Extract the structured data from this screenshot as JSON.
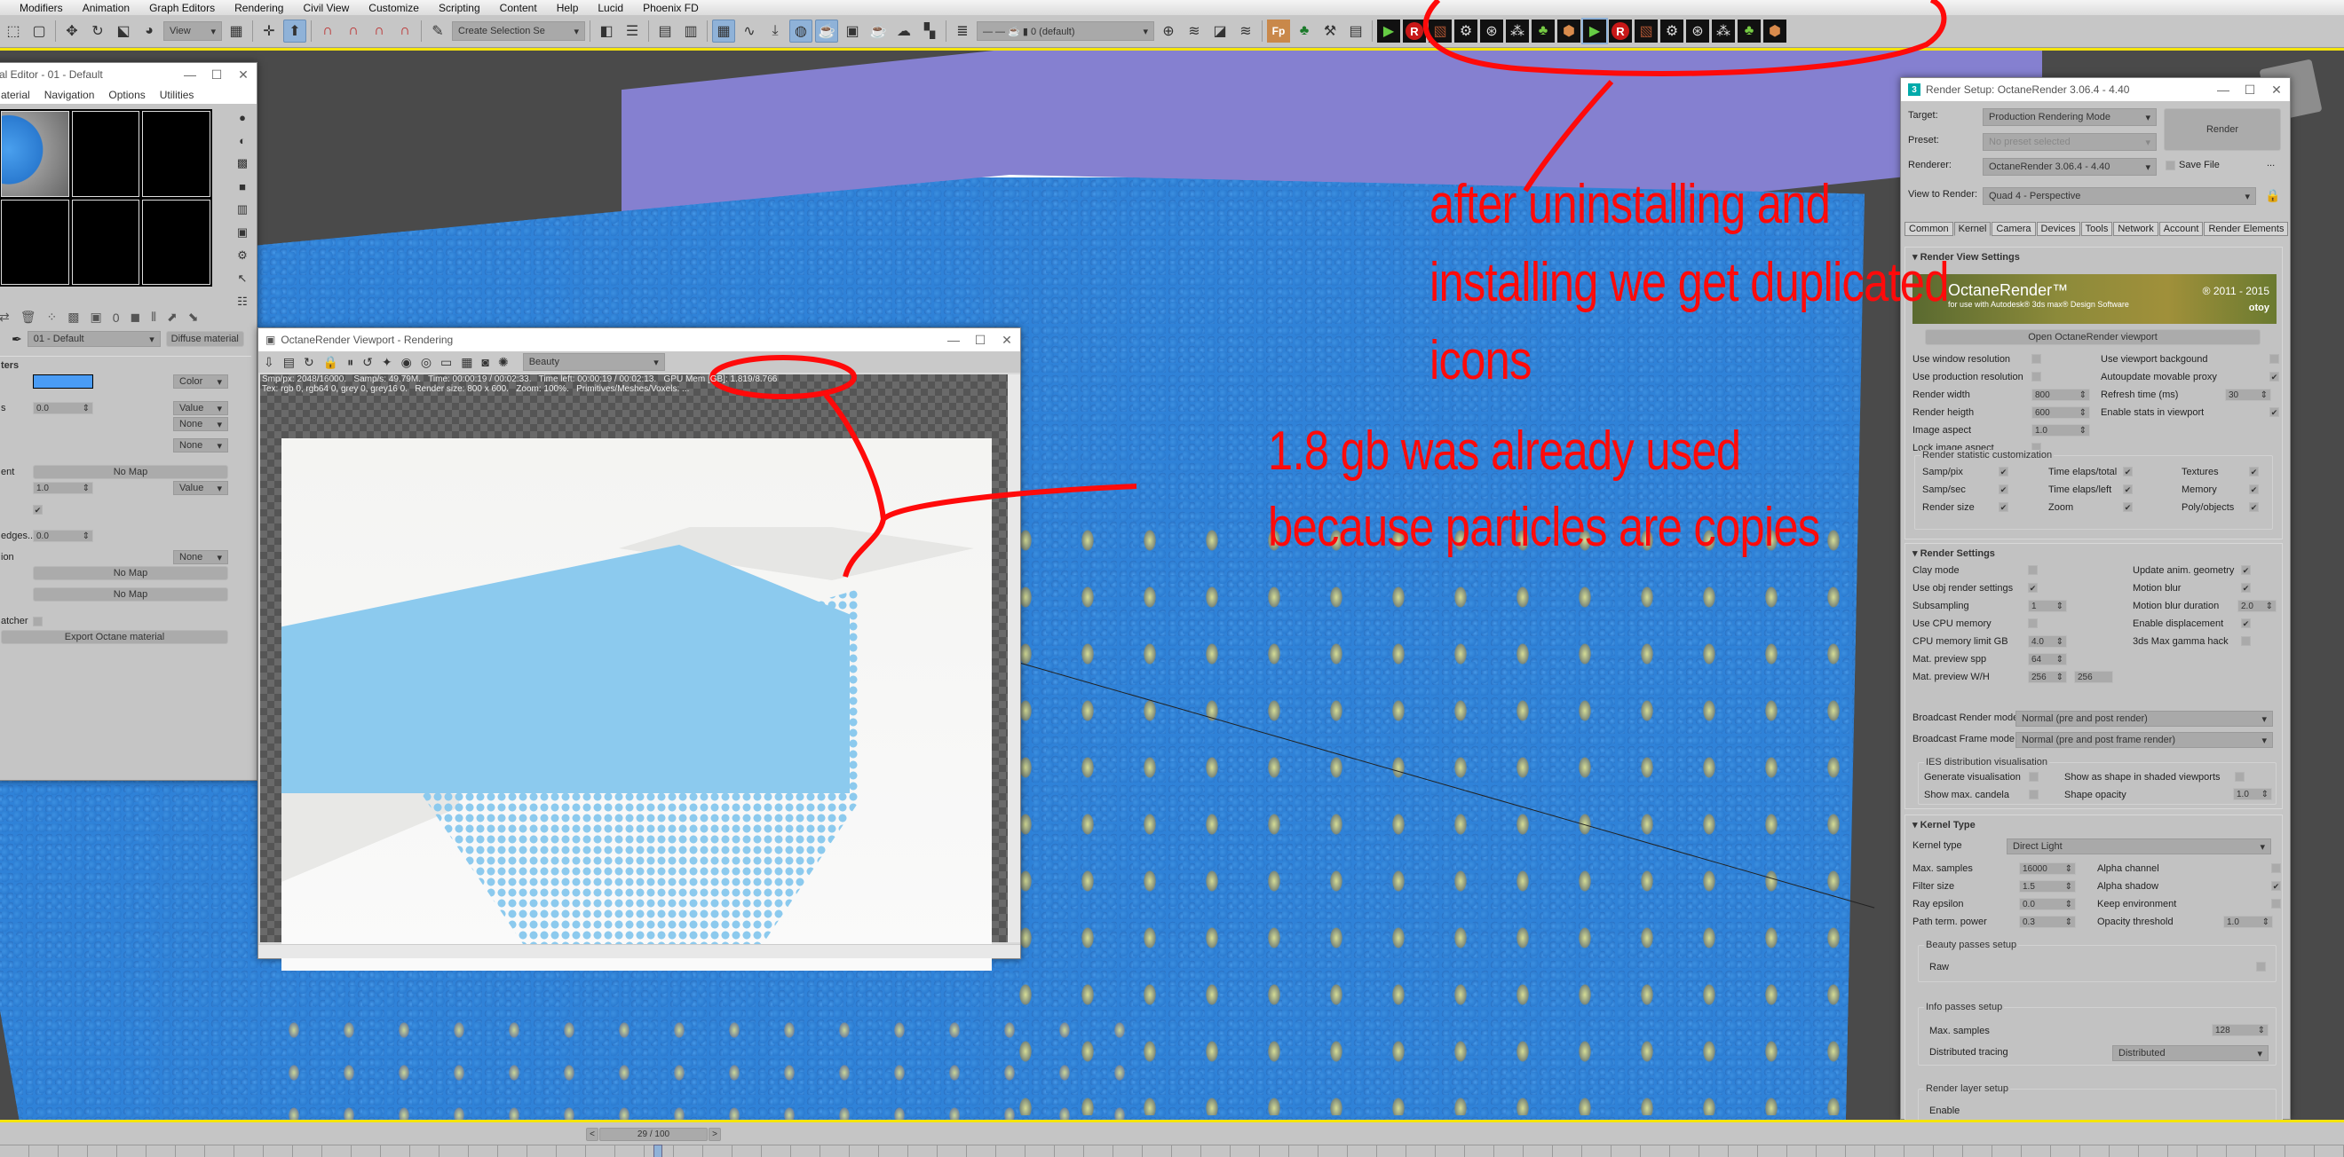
{
  "menubar": [
    "Modifiers",
    "Animation",
    "Graph Editors",
    "Rendering",
    "Civil View",
    "Customize",
    "Scripting",
    "Content",
    "Help",
    "Lucid",
    "Phoenix FD"
  ],
  "toolbar": {
    "view_dropdown": "View",
    "selection_set_dropdown": "Create Selection Se",
    "layer_dropdown": "0 (default)",
    "plugin_icons": [
      "play-flag",
      "render-R",
      "bricks",
      "gear",
      "globe-gear",
      "particles",
      "tree-cluster",
      "cube-box",
      "play-flag",
      "render-R",
      "bricks",
      "gear",
      "globe-gear",
      "particles",
      "tree-cluster",
      "cube-box"
    ]
  },
  "material_editor": {
    "title": "al Editor - 01 - Default",
    "menu": [
      "aterial",
      "Navigation",
      "Options",
      "Utilities"
    ],
    "material_name": "01 - Default",
    "material_type": "Diffuse material",
    "section_title": "ters",
    "color_swatch": "#4a9cf5",
    "rows": [
      {
        "label": "",
        "value": "",
        "type": "Color"
      },
      {
        "label": "s",
        "value": "0.0",
        "type": "Value"
      },
      {
        "label": "",
        "value": "",
        "type": "None"
      },
      {
        "label": "",
        "value": "",
        "type": "None"
      },
      {
        "label": "ent",
        "value": "No Map",
        "type": ""
      },
      {
        "label": "",
        "value": "1.0",
        "type": "Value"
      },
      {
        "label": "",
        "value": "checked",
        "type": ""
      },
      {
        "label": "edges...",
        "value": "0.0",
        "type": ""
      },
      {
        "label": "ion",
        "value": "",
        "type": "None"
      },
      {
        "label": "",
        "value": "No Map",
        "type": ""
      },
      {
        "label": "",
        "value": "No Map",
        "type": ""
      },
      {
        "label": "atcher",
        "value": "unchecked",
        "type": ""
      }
    ],
    "export_button": "Export Octane material"
  },
  "octane_viewport": {
    "title": "OctaneRender Viewport - Rendering",
    "pass_dropdown": "Beauty",
    "stats_line1": "Smp/px: 2048/16000.   Samp/s: 49.79M.   Time: 00:00:19 / 00:02:33.   Time left: 00:00:19 / 00:02:13.   GPU Mem [GB]: 1.819/8.766",
    "stats_line2": "Tex: rgb 0, rgb64 0, grey 0, grey16 0.   Render size: 800 x 600.   Zoom: 100%.   Primitives/Meshes/Voxels: ..."
  },
  "render_setup": {
    "title": "Render Setup: OctaneRender 3.06.4 - 4.40",
    "target_label": "Target:",
    "target_value": "Production Rendering Mode",
    "preset_label": "Preset:",
    "preset_value": "No preset selected",
    "renderer_label": "Renderer:",
    "renderer_value": "OctaneRender 3.06.4 - 4.40",
    "render_button": "Render",
    "save_file": "Save File",
    "more": "...",
    "view_label": "View to Render:",
    "view_value": "Quad 4 - Perspective",
    "tabs": [
      "Common",
      "Kernel",
      "Camera",
      "Devices",
      "Tools",
      "Network",
      "Account",
      "Render Elements"
    ],
    "active_tab": "Kernel",
    "render_view_settings": {
      "title": "Render View Settings",
      "banner_text": "OctaneRender™",
      "banner_sub": "for use with Autodesk® 3ds max® Design Software",
      "banner_copy": "® 2011 - 2015",
      "banner_brand": "otoy",
      "open_button": "Open OctaneRender viewport",
      "left": [
        {
          "label": "Use window resolution",
          "value": "unchecked"
        },
        {
          "label": "Use production resolution",
          "value": "unchecked"
        },
        {
          "label": "Render width",
          "value": "800"
        },
        {
          "label": "Render heigth",
          "value": "600"
        },
        {
          "label": "Image aspect",
          "value": "1.0"
        },
        {
          "label": "Lock image aspect",
          "value": "unchecked"
        }
      ],
      "right": [
        {
          "label": "Use viewport backgound",
          "value": "unchecked"
        },
        {
          "label": "Autoupdate movable proxy",
          "value": "checked"
        },
        {
          "label": "Refresh time (ms)",
          "value": "30"
        },
        {
          "label": "Enable stats in viewport",
          "value": "checked"
        }
      ],
      "stat_group_title": "Render statistic customization",
      "stats": [
        {
          "label": "Samp/pix",
          "checked": true
        },
        {
          "label": "Time elaps/total",
          "checked": true
        },
        {
          "label": "Textures",
          "checked": true
        },
        {
          "label": "Samp/sec",
          "checked": true
        },
        {
          "label": "Time elaps/left",
          "checked": true
        },
        {
          "label": "Memory",
          "checked": true
        },
        {
          "label": "Render size",
          "checked": true
        },
        {
          "label": "Zoom",
          "checked": true
        },
        {
          "label": "Poly/objects",
          "checked": true
        }
      ]
    },
    "render_settings": {
      "title": "Render Settings",
      "left": [
        {
          "label": "Clay mode",
          "value": "unchecked"
        },
        {
          "label": "Use obj render settings",
          "value": "checked"
        },
        {
          "label": "Subsampling",
          "value": "1"
        },
        {
          "label": "Use CPU memory",
          "value": "unchecked"
        },
        {
          "label": "CPU memory limit GB",
          "value": "4.0"
        },
        {
          "label": "Mat. preview spp",
          "value": "64"
        },
        {
          "label": "Mat. preview W/H",
          "value": "256",
          "value2": "256"
        }
      ],
      "right": [
        {
          "label": "Update anim. geometry",
          "value": "checked"
        },
        {
          "label": "Motion blur",
          "value": "checked"
        },
        {
          "label": "Motion blur duration",
          "value": "2.0"
        },
        {
          "label": "Enable displacement",
          "value": "checked"
        },
        {
          "label": "3ds Max gamma hack",
          "value": "unchecked"
        }
      ],
      "broadcast_render_label": "Broadcast Render mode",
      "broadcast_render_value": "Normal (pre and post render)",
      "broadcast_frame_label": "Broadcast Frame mode",
      "broadcast_frame_value": "Normal (pre and post frame render)",
      "ies_title": "IES distribution visualisation",
      "ies": [
        {
          "label": "Generate visualisation",
          "value": "unchecked"
        },
        {
          "label": "Show as shape in shaded viewports",
          "value": "unchecked"
        },
        {
          "label": "Show max. candela",
          "value": "unchecked"
        },
        {
          "label": "Shape opacity",
          "value": "1.0"
        }
      ]
    },
    "kernel_type": {
      "title": "Kernel Type",
      "kernel_label": "Kernel type",
      "kernel_value": "Direct Light",
      "left": [
        {
          "label": "Max. samples",
          "value": "16000"
        },
        {
          "label": "Filter size",
          "value": "1.5"
        },
        {
          "label": "Ray epsilon",
          "value": "0.0"
        },
        {
          "label": "Path term. power",
          "value": "0.3"
        }
      ],
      "right": [
        {
          "label": "Alpha channel",
          "value": "unchecked"
        },
        {
          "label": "Alpha shadow",
          "value": "checked"
        },
        {
          "label": "Keep environment",
          "value": "unchecked"
        },
        {
          "label": "Opacity threshold",
          "value": "1.0"
        }
      ],
      "beauty_title": "Beauty passes setup",
      "beauty_raw": "Raw",
      "info_title": "Info passes setup",
      "info_max_samples_label": "Max. samples",
      "info_max_samples": "128",
      "distributed_label": "Distributed tracing",
      "distributed_value": "Distributed",
      "layer_title": "Render layer setup",
      "layer_enable": "Enable"
    }
  },
  "annotations": {
    "text1_line1": "after uninstalling and",
    "text1_line2": "installing  we get duplicated",
    "text1_line3": "icons",
    "text2_line1": "1.8  gb was already used",
    "text2_line2": "because particles are copies",
    "color": "#ff0a0a"
  },
  "timeline": {
    "prev": "<",
    "frame": "29 / 100",
    "next": ">",
    "progress": 0.29
  }
}
